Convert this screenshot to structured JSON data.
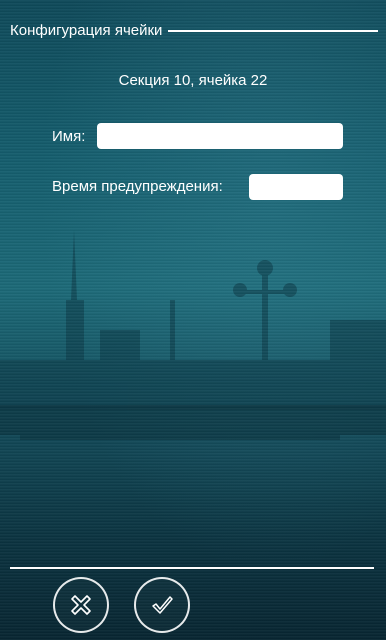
{
  "dialog": {
    "title": "Конфигурация ячейки",
    "section_label": "Секция 10, ячейка 22"
  },
  "form": {
    "name_label": "Имя:",
    "name_value": "",
    "warning_time_label": "Время предупреждения:",
    "warning_time_value": ""
  },
  "buttons": {
    "cancel_icon": "cross-icon",
    "confirm_icon": "checkmark-icon"
  },
  "colors": {
    "text": "#ffffff",
    "background_top": "#0f4a5a",
    "background_bottom": "#082632"
  }
}
